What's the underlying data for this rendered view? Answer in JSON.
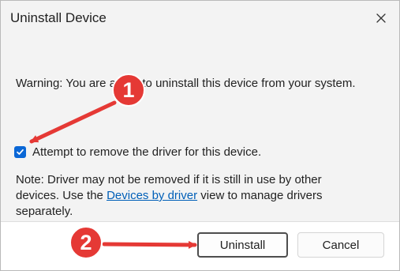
{
  "window": {
    "title": "Uninstall Device"
  },
  "icons": {
    "close": "close-icon",
    "checkmark": "checkmark-icon"
  },
  "content": {
    "warning_text": "Warning: You are about to uninstall this device from your system.",
    "checkbox": {
      "label": "Attempt to remove the driver for this device.",
      "checked": true
    },
    "note": {
      "line1": "Note: Driver may not be removed if it is still in use by other",
      "line2_before_link": "devices. Use the ",
      "link_text": "Devices by driver",
      "line2_after_link": " view to manage drivers",
      "line3": "separately."
    }
  },
  "buttons": {
    "uninstall": "Uninstall",
    "cancel": "Cancel"
  },
  "annotations": {
    "step_1": "1",
    "step_2": "2",
    "color": "#e53935"
  }
}
